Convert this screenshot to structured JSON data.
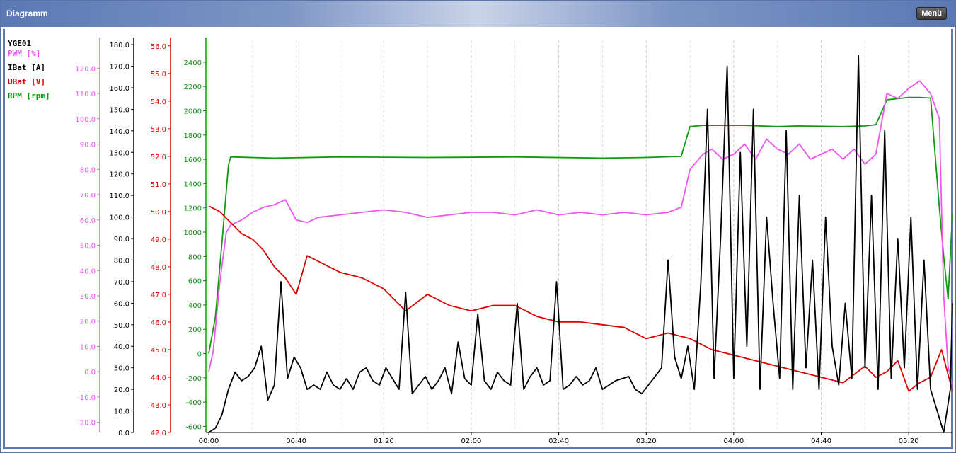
{
  "window": {
    "title": "Diagramm",
    "menu_label": "Menü"
  },
  "legend": {
    "group": "YGE01",
    "items": [
      {
        "label": "PWM [%]",
        "color": "#ee55ee"
      },
      {
        "label": "IBat [A]",
        "color": "#000000"
      },
      {
        "label": "UBat [V]",
        "color": "#dd0000"
      },
      {
        "label": "RPM [rpm]",
        "color": "#119911"
      }
    ]
  },
  "chart_data": {
    "type": "line",
    "xlabel": "",
    "x_ticks": [
      "00:00",
      "00:40",
      "01:20",
      "02:00",
      "02:40",
      "03:20",
      "04:00",
      "04:40",
      "05:20"
    ],
    "x_range_s": [
      0,
      340
    ],
    "axes": [
      {
        "name": "PWM [%]",
        "color": "#ee55ee",
        "range": [
          -24,
          131
        ],
        "ticks": [
          -20.0,
          -10.0,
          0.0,
          10.0,
          20.0,
          30.0,
          40.0,
          50.0,
          60.0,
          70.0,
          80.0,
          90.0,
          100.0,
          110.0,
          120.0
        ]
      },
      {
        "name": "IBat [A]",
        "color": "#000000",
        "range": [
          0,
          182
        ],
        "ticks": [
          0.0,
          10.0,
          20.0,
          30.0,
          40.0,
          50.0,
          60.0,
          70.0,
          80.0,
          90.0,
          100.0,
          110.0,
          120.0,
          130.0,
          140.0,
          150.0,
          160.0,
          170.0,
          180.0
        ]
      },
      {
        "name": "UBat [V]",
        "color": "#dd0000",
        "range": [
          42,
          56.2
        ],
        "ticks": [
          42.0,
          43.0,
          44.0,
          45.0,
          46.0,
          47.0,
          48.0,
          49.0,
          50.0,
          51.0,
          52.0,
          53.0,
          54.0,
          55.0,
          56.0
        ]
      },
      {
        "name": "RPM [rpm]",
        "color": "#119911",
        "range": [
          -650,
          2580
        ],
        "ticks": [
          -600,
          -400,
          -200,
          0,
          200,
          400,
          600,
          800,
          1000,
          1200,
          1400,
          1600,
          1800,
          2000,
          2200,
          2400
        ]
      }
    ],
    "series": [
      {
        "name": "RPM [rpm]",
        "axis": 3,
        "color": "#119911",
        "x": [
          0,
          3,
          6,
          9,
          10,
          30,
          60,
          100,
          140,
          180,
          200,
          216,
          220,
          226,
          245,
          260,
          270,
          290,
          300,
          305,
          310,
          315,
          320,
          325,
          330,
          334,
          336,
          338,
          340
        ],
        "y": [
          0,
          300,
          900,
          1550,
          1620,
          1610,
          1620,
          1615,
          1620,
          1610,
          1615,
          1625,
          1870,
          1880,
          1880,
          1870,
          1875,
          1870,
          1875,
          1885,
          2090,
          2100,
          2110,
          2110,
          2105,
          1200,
          800,
          450,
          1150
        ]
      },
      {
        "name": "PWM [%]",
        "axis": 0,
        "color": "#ee55ee",
        "x": [
          0,
          2,
          5,
          8,
          10,
          15,
          20,
          25,
          30,
          35,
          40,
          45,
          50,
          60,
          70,
          80,
          90,
          100,
          110,
          120,
          130,
          140,
          150,
          160,
          170,
          180,
          190,
          200,
          210,
          216,
          220,
          226,
          230,
          235,
          240,
          245,
          250,
          255,
          260,
          265,
          270,
          275,
          280,
          285,
          290,
          295,
          300,
          305,
          310,
          315,
          320,
          325,
          330,
          334,
          336,
          338,
          340
        ],
        "y": [
          0,
          8,
          35,
          55,
          58,
          60,
          63,
          65,
          66,
          68,
          60,
          59,
          61,
          62,
          63,
          64,
          63,
          61,
          62,
          63,
          63,
          62,
          64,
          62,
          63,
          62,
          63,
          62,
          63,
          65,
          80,
          86,
          88,
          84,
          86,
          90,
          84,
          92,
          88,
          86,
          90,
          84,
          86,
          88,
          84,
          88,
          82,
          86,
          110,
          108,
          112,
          115,
          110,
          100,
          30,
          2,
          -5
        ]
      },
      {
        "name": "UBat [V]",
        "axis": 2,
        "color": "#dd0000",
        "x": [
          0,
          5,
          10,
          15,
          20,
          25,
          30,
          35,
          40,
          45,
          50,
          55,
          60,
          70,
          80,
          90,
          100,
          110,
          120,
          130,
          140,
          150,
          160,
          170,
          180,
          190,
          200,
          210,
          220,
          230,
          240,
          250,
          260,
          270,
          280,
          290,
          300,
          305,
          310,
          315,
          320,
          325,
          330,
          335,
          340
        ],
        "y": [
          50.2,
          50.0,
          49.6,
          49.2,
          49.0,
          48.6,
          48.0,
          47.6,
          47.0,
          48.4,
          48.2,
          48.0,
          47.8,
          47.6,
          47.2,
          46.4,
          47.0,
          46.6,
          46.4,
          46.6,
          46.6,
          46.2,
          46.0,
          46.0,
          45.9,
          45.8,
          45.4,
          45.6,
          45.4,
          45.0,
          44.8,
          44.6,
          44.4,
          44.2,
          44.0,
          43.8,
          44.4,
          44.0,
          44.2,
          44.6,
          43.5,
          43.8,
          44.0,
          45.0,
          43.5
        ]
      },
      {
        "name": "IBat [A]",
        "axis": 1,
        "color": "#000000",
        "x": [
          0,
          3,
          6,
          9,
          12,
          15,
          18,
          21,
          24,
          27,
          30,
          33,
          36,
          39,
          42,
          45,
          48,
          51,
          54,
          57,
          60,
          63,
          66,
          69,
          72,
          75,
          78,
          81,
          84,
          87,
          90,
          93,
          96,
          99,
          102,
          105,
          108,
          111,
          114,
          117,
          120,
          123,
          126,
          129,
          132,
          135,
          138,
          141,
          144,
          147,
          150,
          153,
          156,
          159,
          162,
          165,
          168,
          171,
          174,
          177,
          180,
          183,
          186,
          189,
          192,
          195,
          198,
          201,
          204,
          207,
          210,
          213,
          216,
          219,
          222,
          225,
          228,
          231,
          234,
          237,
          240,
          243,
          246,
          249,
          252,
          255,
          258,
          261,
          264,
          267,
          270,
          273,
          276,
          279,
          282,
          285,
          288,
          291,
          294,
          297,
          300,
          303,
          306,
          309,
          312,
          315,
          318,
          321,
          324,
          327,
          330,
          333,
          336,
          339,
          340
        ],
        "y": [
          0,
          2,
          8,
          20,
          28,
          24,
          26,
          30,
          40,
          15,
          22,
          70,
          25,
          35,
          30,
          20,
          22,
          20,
          28,
          22,
          20,
          25,
          20,
          28,
          30,
          24,
          22,
          30,
          25,
          20,
          65,
          18,
          22,
          26,
          20,
          24,
          30,
          18,
          42,
          25,
          22,
          55,
          24,
          20,
          28,
          24,
          22,
          60,
          20,
          26,
          30,
          22,
          24,
          70,
          20,
          22,
          26,
          22,
          24,
          30,
          20,
          22,
          24,
          25,
          26,
          20,
          18,
          22,
          26,
          30,
          80,
          35,
          25,
          40,
          20,
          70,
          150,
          25,
          90,
          170,
          25,
          130,
          40,
          150,
          20,
          100,
          60,
          25,
          140,
          20,
          110,
          30,
          80,
          20,
          100,
          40,
          22,
          60,
          25,
          175,
          30,
          110,
          20,
          140,
          25,
          90,
          30,
          100,
          20,
          80,
          20,
          10,
          0,
          20,
          60
        ]
      }
    ]
  }
}
